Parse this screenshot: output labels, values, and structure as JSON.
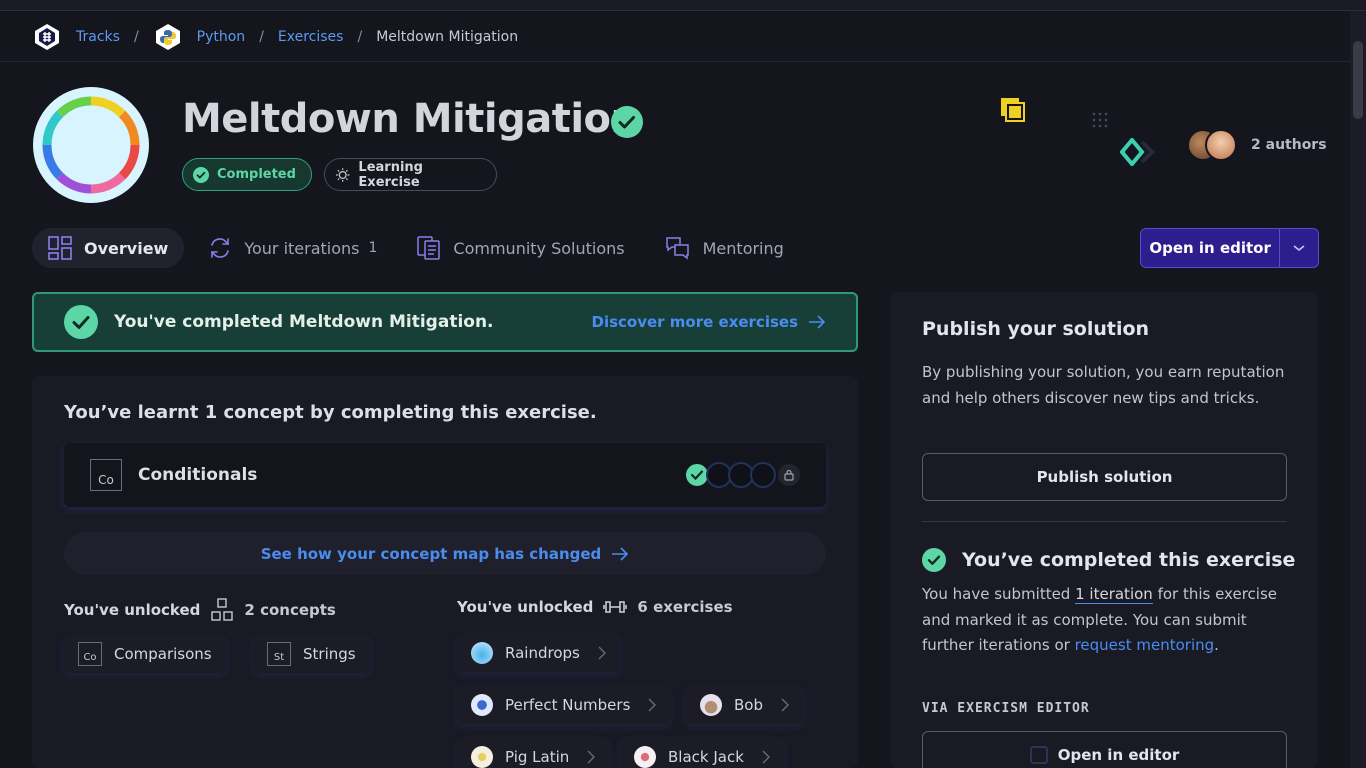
{
  "breadcrumb": {
    "tracks": "Tracks",
    "python": "Python",
    "exercises": "Exercises",
    "current": "Meltdown Mitigation",
    "separator": "/"
  },
  "exercise": {
    "title": "Meltdown Mitigation",
    "status_pill": "Completed",
    "type_pill": "Learning Exercise",
    "authors_label": "2 authors"
  },
  "tabs": [
    {
      "label": "Overview",
      "icon": "overview-icon",
      "active": true
    },
    {
      "label": "Your iterations",
      "count": "1",
      "icon": "iterations-icon"
    },
    {
      "label": "Community Solutions",
      "icon": "community-solutions-icon"
    },
    {
      "label": "Mentoring",
      "icon": "mentoring-icon"
    }
  ],
  "open_editor": {
    "label": "Open in editor"
  },
  "completed_banner": {
    "message": "You've completed Meltdown Mitigation.",
    "link": "Discover more exercises"
  },
  "concepts": {
    "heading": "You’ve learnt 1 concept by completing this exercise.",
    "learnt": {
      "abbr": "Co",
      "name": "Conditionals"
    },
    "map_link": "See how your concept map has changed",
    "unlocked_concepts_prefix": "You've unlocked",
    "unlocked_concepts_count": "2 concepts",
    "unlocked_exercises_prefix": "You've unlocked",
    "unlocked_exercises_count": "6 exercises",
    "concept_chips": [
      {
        "abbr": "Co",
        "name": "Comparisons"
      },
      {
        "abbr": "St",
        "name": "Strings"
      }
    ],
    "exercise_chips": [
      {
        "name": "Raindrops",
        "color": "#4ab0e8"
      },
      {
        "name": "Perfect Numbers",
        "color": "#3a6ad0"
      },
      {
        "name": "Bob",
        "color": "#b09070"
      },
      {
        "name": "Pig Latin",
        "color": "#e8d060"
      },
      {
        "name": "Black Jack",
        "color": "#e06a7a"
      }
    ]
  },
  "publish": {
    "title": "Publish your solution",
    "text": "By publishing your solution, you earn reputation and help others discover new tips and tricks.",
    "button": "Publish solution",
    "done_title": "You’ve completed this exercise",
    "done_text_1": "You have submitted ",
    "done_iter": "1 iteration",
    "done_text_2": " for this exercise and marked it as complete. You can submit further iterations or ",
    "done_request": "request mentoring",
    "done_text_3": ".",
    "via": "VIA EXERCISM EDITOR",
    "open_editor": "Open in editor"
  },
  "colors": {
    "accent_blue": "#4a8cf0",
    "success_green": "#5cd6a7",
    "editor_purple": "#2e1d8c",
    "background": "#15151e"
  }
}
